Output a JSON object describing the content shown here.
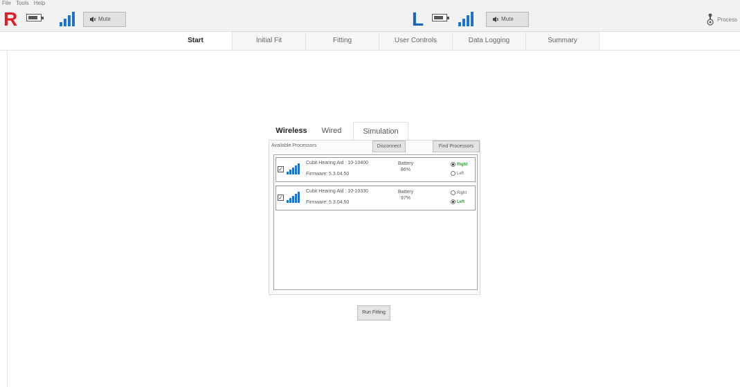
{
  "menu": [
    "File",
    "Tools",
    "Help"
  ],
  "right_ear": {
    "letter": "R",
    "color": "#e01c24",
    "mute_label": "Mute"
  },
  "left_ear": {
    "letter": "L",
    "color": "#1565c0",
    "mute_label": "Mute"
  },
  "processor_label": "Process",
  "main_tabs": [
    {
      "label": "Start",
      "active": true
    },
    {
      "label": "Initial Fit",
      "active": false
    },
    {
      "label": "Fitting",
      "active": false
    },
    {
      "label": "User Controls",
      "active": false
    },
    {
      "label": "Data Logging",
      "active": false
    },
    {
      "label": "Summary",
      "active": false
    }
  ],
  "connection_tabs": [
    {
      "label": "Wireless",
      "active": true
    },
    {
      "label": "Wired",
      "active": false
    },
    {
      "label": "Simulation",
      "active": false
    }
  ],
  "available_label": "Available Processors",
  "disconnect_label": "Disconnect",
  "find_label": "Find Processors",
  "devices": [
    {
      "checked": true,
      "name": "Cubit Hearing Aid : 10-10400",
      "firmware": "Firmware: 5.3.04.50",
      "battery_label": "Battery",
      "battery_value": "86%",
      "side": "Right",
      "right_option": "Right",
      "left_option": "Left"
    },
    {
      "checked": true,
      "name": "Cubit Hearing Aid : 10-10330",
      "firmware": "Firmware: 5.3.04.50",
      "battery_label": "Battery",
      "battery_value": "97%",
      "side": "Left",
      "right_option": "Right",
      "left_option": "Left"
    }
  ],
  "run_fitting_label": "Run Fitting",
  "colors": {
    "signal_blue": "#1e73d2",
    "selected_green": "#2e9b3a"
  }
}
